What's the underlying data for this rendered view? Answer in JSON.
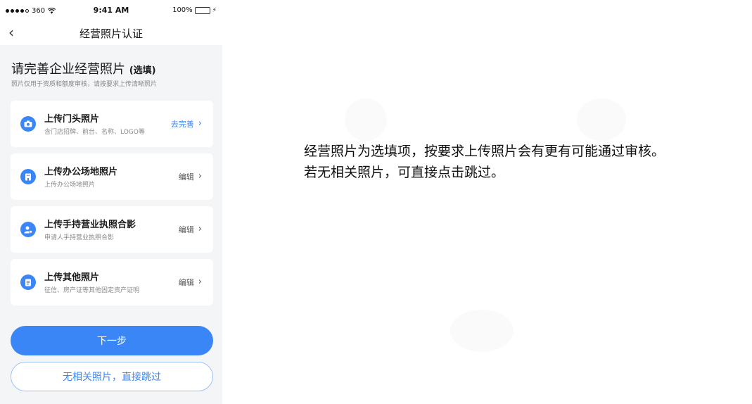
{
  "status_bar": {
    "carrier": "360",
    "time": "9:41 AM",
    "battery": "100%"
  },
  "nav": {
    "title": "经营照片认证"
  },
  "section": {
    "title": "请完善企业经营照片",
    "optional": "(选填)",
    "subtitle": "照片仅用于资质和额度审核，请按要求上传清晰照片"
  },
  "items": [
    {
      "title": "上传门头照片",
      "desc": "含门店招牌、前台、名称、LOGO等",
      "action": "去完善",
      "icon": "camera-icon"
    },
    {
      "title": "上传办公场地照片",
      "desc": "上传办公场地照片",
      "action": "编辑",
      "icon": "building-icon"
    },
    {
      "title": "上传手持营业执照合影",
      "desc": "申请人手持营业执照合影",
      "action": "编辑",
      "icon": "user-card-icon"
    },
    {
      "title": "上传其他照片",
      "desc": "征信、房产证等其他固定资产证明",
      "action": "编辑",
      "icon": "document-icon"
    }
  ],
  "buttons": {
    "next": "下一步",
    "skip": "无相关照片，直接跳过"
  },
  "annotation": {
    "line1": "经营照片为选填项，按要求上传照片会有更有可能通过审核。",
    "line2": "若无相关照片，可直接点击跳过。"
  },
  "colors": {
    "accent": "#3b86f6",
    "background": "#f4f5f7",
    "battery": "#2bc84d"
  }
}
